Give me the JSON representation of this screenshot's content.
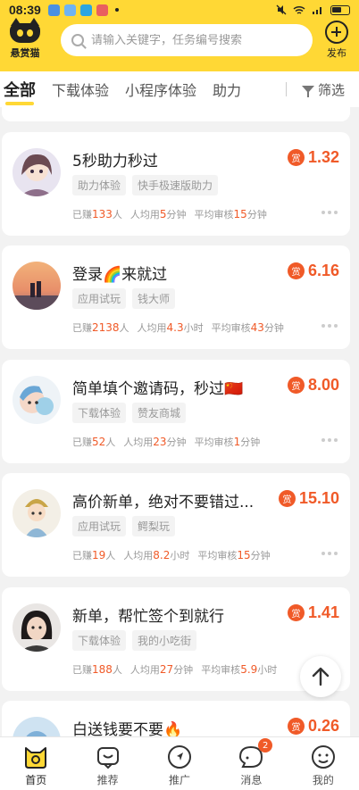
{
  "status_bar": {
    "time": "08:39"
  },
  "header": {
    "logo_text": "悬赏猫",
    "search_placeholder": "请输入关键字，任务编号搜索",
    "publish_label": "发布"
  },
  "tabs": [
    "全部",
    "下载体验",
    "小程序体验",
    "助力"
  ],
  "filter_label": "筛选",
  "tasks": [
    {
      "title": "5秒助力秒过",
      "reward": "1.32",
      "tags": [
        "助力体验",
        "快手极速版助力"
      ],
      "earned": "133",
      "per_user": "5",
      "per_user_unit": "分钟",
      "review": "15",
      "review_unit": "分钟"
    },
    {
      "title": "登录🌈来就过",
      "reward": "6.16",
      "tags": [
        "应用试玩",
        "钱大师"
      ],
      "earned": "2138",
      "per_user": "4.3",
      "per_user_unit": "小时",
      "review": "43",
      "review_unit": "分钟"
    },
    {
      "title": "简单填个邀请码，秒过🇨🇳",
      "reward": "8.00",
      "tags": [
        "下载体验",
        "赞友商城"
      ],
      "earned": "52",
      "per_user": "23",
      "per_user_unit": "分钟",
      "review": "1",
      "review_unit": "分钟"
    },
    {
      "title": "高价新单，绝对不要错过...",
      "reward": "15.10",
      "tags": [
        "应用试玩",
        "鳄梨玩"
      ],
      "earned": "19",
      "per_user": "8.2",
      "per_user_unit": "小时",
      "review": "15",
      "review_unit": "分钟"
    },
    {
      "title": "新单，帮忙签个到就行",
      "reward": "1.41",
      "tags": [
        "下载体验",
        "我的小吃街"
      ],
      "earned": "188",
      "per_user": "27",
      "per_user_unit": "分钟",
      "review": "5.9",
      "review_unit": "小时"
    },
    {
      "title": "白送钱要不要🔥",
      "reward": "0.26",
      "tags": [],
      "earned": "",
      "per_user": "",
      "per_user_unit": "",
      "review": "",
      "review_unit": ""
    }
  ],
  "labels": {
    "reward_icon": "赏",
    "earned_prefix": "已赚",
    "earned_suffix": "人",
    "per_user_prefix": "人均用",
    "review_prefix": "平均审核"
  },
  "bottom_nav": [
    {
      "label": "首页",
      "icon": "home-cat-icon",
      "active": true
    },
    {
      "label": "推荐",
      "icon": "recommend-icon"
    },
    {
      "label": "推广",
      "icon": "promote-icon"
    },
    {
      "label": "消息",
      "icon": "message-icon",
      "badge": "2"
    },
    {
      "label": "我的",
      "icon": "profile-icon"
    }
  ],
  "colors": {
    "brand_yellow": "#ffd835",
    "accent_orange": "#f05a28"
  }
}
